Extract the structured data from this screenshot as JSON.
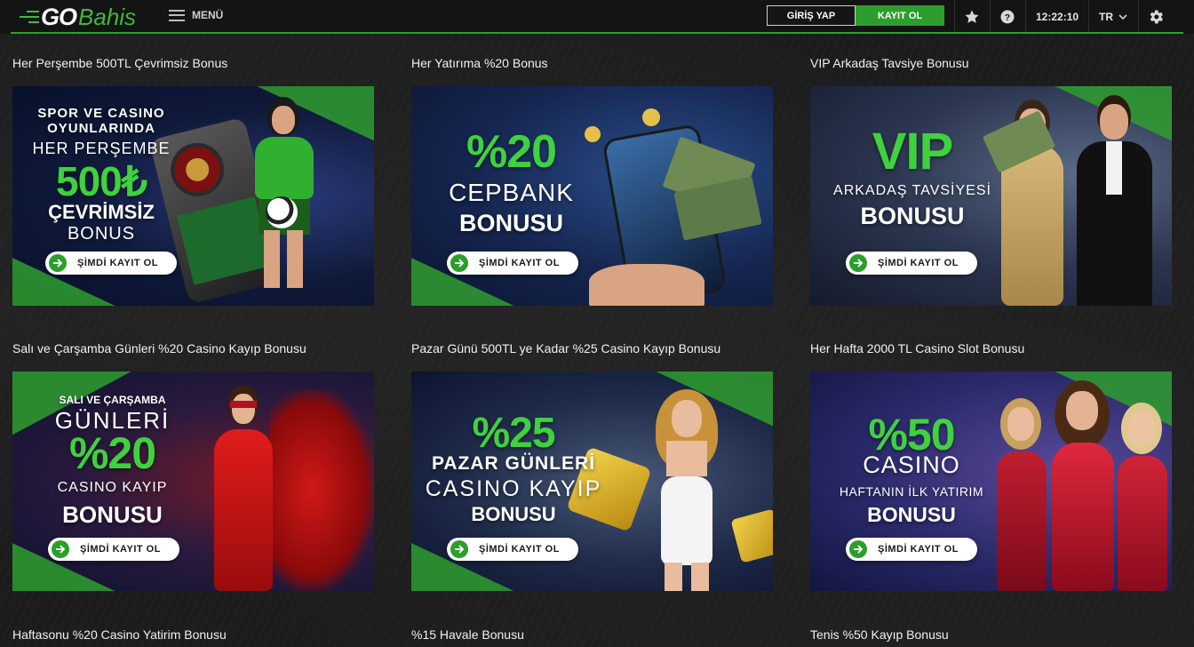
{
  "header": {
    "logo_go": "GO",
    "logo_bahis": "Bahis",
    "menu_label": "MENÜ",
    "login_label": "GİRİŞ YAP",
    "register_label": "KAYIT OL",
    "clock": "12:22:10",
    "language": "TR",
    "icons": [
      "star-icon",
      "help-icon",
      "gear-icon",
      "chevron-down-icon",
      "hamburger-icon"
    ]
  },
  "cta_label": "ŞİMDİ KAYIT OL",
  "colors": {
    "brand_green": "#2f9e2f",
    "accent_green": "#3fd13f",
    "header_bg": "#141414",
    "page_bg": "#1c1c1c"
  },
  "promos": [
    {
      "title": "Her Perşembe 500TL Çevrimsiz Bonus",
      "lines": [
        "SPOR VE CASINO",
        "OYUNLARINDA",
        "HER PERŞEMBE",
        "500₺",
        "ÇEVRİMSİZ",
        "BONUS"
      ]
    },
    {
      "title": "Her Yatırıma %20 Bonus",
      "lines": [
        "%20",
        "CEPBANK",
        "BONUSU"
      ]
    },
    {
      "title": "VIP Arkadaş Tavsiye Bonusu",
      "lines": [
        "VIP",
        "ARKADAŞ TAVSİYESİ",
        "BONUSU"
      ]
    },
    {
      "title": "Salı ve Çarşamba Günleri %20 Casino Kayıp Bonusu",
      "lines": [
        "SALI VE ÇARŞAMBA",
        "GÜNLERİ",
        "%20",
        "CASINO KAYIP",
        "BONUSU"
      ]
    },
    {
      "title": "Pazar Günü 500TL ye Kadar %25 Casino Kayıp Bonusu",
      "lines": [
        "%25",
        "PAZAR GÜNLERİ",
        "CASINO KAYIP",
        "BONUSU"
      ]
    },
    {
      "title": "Her Hafta 2000 TL Casino Slot Bonusu",
      "lines": [
        "%50",
        "CASINO",
        "HAFTANIN İLK YATIRIM",
        "BONUSU"
      ]
    },
    {
      "title": "Haftasonu %20 Casino Yatirim Bonusu"
    },
    {
      "title": "%15 Havale Bonusu"
    },
    {
      "title": "Tenis %50 Kayıp Bonusu"
    }
  ]
}
